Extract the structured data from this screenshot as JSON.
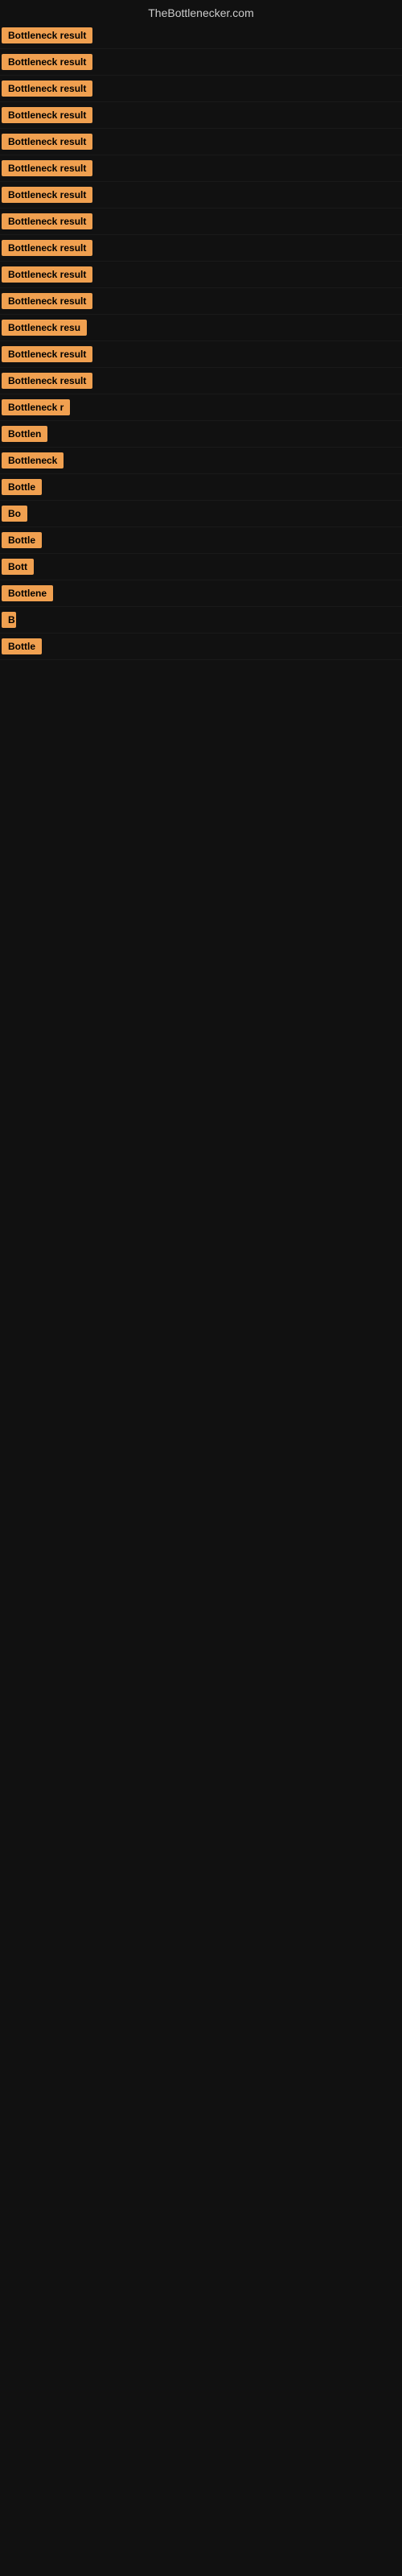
{
  "site": {
    "title": "TheBottlenecker.com"
  },
  "rows": [
    {
      "id": 1,
      "label": "Bottleneck result",
      "width": 155
    },
    {
      "id": 2,
      "label": "Bottleneck result",
      "width": 155
    },
    {
      "id": 3,
      "label": "Bottleneck result",
      "width": 155
    },
    {
      "id": 4,
      "label": "Bottleneck result",
      "width": 155
    },
    {
      "id": 5,
      "label": "Bottleneck result",
      "width": 155
    },
    {
      "id": 6,
      "label": "Bottleneck result",
      "width": 155
    },
    {
      "id": 7,
      "label": "Bottleneck result",
      "width": 155
    },
    {
      "id": 8,
      "label": "Bottleneck result",
      "width": 155
    },
    {
      "id": 9,
      "label": "Bottleneck result",
      "width": 155
    },
    {
      "id": 10,
      "label": "Bottleneck result",
      "width": 155
    },
    {
      "id": 11,
      "label": "Bottleneck result",
      "width": 155
    },
    {
      "id": 12,
      "label": "Bottleneck resu",
      "width": 130
    },
    {
      "id": 13,
      "label": "Bottleneck result",
      "width": 140
    },
    {
      "id": 14,
      "label": "Bottleneck result",
      "width": 130
    },
    {
      "id": 15,
      "label": "Bottleneck r",
      "width": 100
    },
    {
      "id": 16,
      "label": "Bottlen",
      "width": 72
    },
    {
      "id": 17,
      "label": "Bottleneck",
      "width": 85
    },
    {
      "id": 18,
      "label": "Bottle",
      "width": 62
    },
    {
      "id": 19,
      "label": "Bo",
      "width": 34
    },
    {
      "id": 20,
      "label": "Bottle",
      "width": 62
    },
    {
      "id": 21,
      "label": "Bott",
      "width": 48
    },
    {
      "id": 22,
      "label": "Bottlene",
      "width": 76
    },
    {
      "id": 23,
      "label": "B",
      "width": 18
    },
    {
      "id": 24,
      "label": "Bottle",
      "width": 62
    }
  ]
}
